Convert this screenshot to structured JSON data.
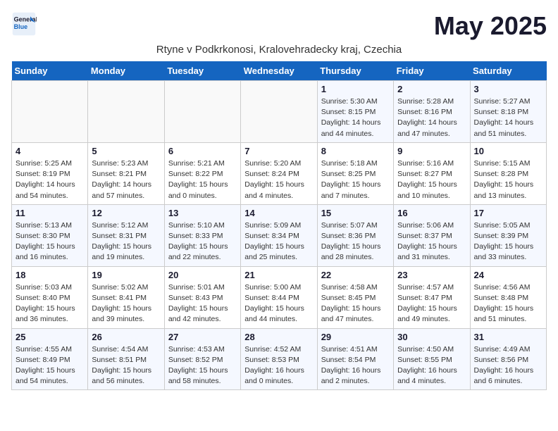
{
  "logo": {
    "line1": "General",
    "line2": "Blue"
  },
  "title": "May 2025",
  "subtitle": "Rtyne v Podkrkonosi, Kralovehradecky kraj, Czechia",
  "days_of_week": [
    "Sunday",
    "Monday",
    "Tuesday",
    "Wednesday",
    "Thursday",
    "Friday",
    "Saturday"
  ],
  "weeks": [
    [
      {
        "day": "",
        "info": ""
      },
      {
        "day": "",
        "info": ""
      },
      {
        "day": "",
        "info": ""
      },
      {
        "day": "",
        "info": ""
      },
      {
        "day": "1",
        "info": "Sunrise: 5:30 AM\nSunset: 8:15 PM\nDaylight: 14 hours\nand 44 minutes."
      },
      {
        "day": "2",
        "info": "Sunrise: 5:28 AM\nSunset: 8:16 PM\nDaylight: 14 hours\nand 47 minutes."
      },
      {
        "day": "3",
        "info": "Sunrise: 5:27 AM\nSunset: 8:18 PM\nDaylight: 14 hours\nand 51 minutes."
      }
    ],
    [
      {
        "day": "4",
        "info": "Sunrise: 5:25 AM\nSunset: 8:19 PM\nDaylight: 14 hours\nand 54 minutes."
      },
      {
        "day": "5",
        "info": "Sunrise: 5:23 AM\nSunset: 8:21 PM\nDaylight: 14 hours\nand 57 minutes."
      },
      {
        "day": "6",
        "info": "Sunrise: 5:21 AM\nSunset: 8:22 PM\nDaylight: 15 hours\nand 0 minutes."
      },
      {
        "day": "7",
        "info": "Sunrise: 5:20 AM\nSunset: 8:24 PM\nDaylight: 15 hours\nand 4 minutes."
      },
      {
        "day": "8",
        "info": "Sunrise: 5:18 AM\nSunset: 8:25 PM\nDaylight: 15 hours\nand 7 minutes."
      },
      {
        "day": "9",
        "info": "Sunrise: 5:16 AM\nSunset: 8:27 PM\nDaylight: 15 hours\nand 10 minutes."
      },
      {
        "day": "10",
        "info": "Sunrise: 5:15 AM\nSunset: 8:28 PM\nDaylight: 15 hours\nand 13 minutes."
      }
    ],
    [
      {
        "day": "11",
        "info": "Sunrise: 5:13 AM\nSunset: 8:30 PM\nDaylight: 15 hours\nand 16 minutes."
      },
      {
        "day": "12",
        "info": "Sunrise: 5:12 AM\nSunset: 8:31 PM\nDaylight: 15 hours\nand 19 minutes."
      },
      {
        "day": "13",
        "info": "Sunrise: 5:10 AM\nSunset: 8:33 PM\nDaylight: 15 hours\nand 22 minutes."
      },
      {
        "day": "14",
        "info": "Sunrise: 5:09 AM\nSunset: 8:34 PM\nDaylight: 15 hours\nand 25 minutes."
      },
      {
        "day": "15",
        "info": "Sunrise: 5:07 AM\nSunset: 8:36 PM\nDaylight: 15 hours\nand 28 minutes."
      },
      {
        "day": "16",
        "info": "Sunrise: 5:06 AM\nSunset: 8:37 PM\nDaylight: 15 hours\nand 31 minutes."
      },
      {
        "day": "17",
        "info": "Sunrise: 5:05 AM\nSunset: 8:39 PM\nDaylight: 15 hours\nand 33 minutes."
      }
    ],
    [
      {
        "day": "18",
        "info": "Sunrise: 5:03 AM\nSunset: 8:40 PM\nDaylight: 15 hours\nand 36 minutes."
      },
      {
        "day": "19",
        "info": "Sunrise: 5:02 AM\nSunset: 8:41 PM\nDaylight: 15 hours\nand 39 minutes."
      },
      {
        "day": "20",
        "info": "Sunrise: 5:01 AM\nSunset: 8:43 PM\nDaylight: 15 hours\nand 42 minutes."
      },
      {
        "day": "21",
        "info": "Sunrise: 5:00 AM\nSunset: 8:44 PM\nDaylight: 15 hours\nand 44 minutes."
      },
      {
        "day": "22",
        "info": "Sunrise: 4:58 AM\nSunset: 8:45 PM\nDaylight: 15 hours\nand 47 minutes."
      },
      {
        "day": "23",
        "info": "Sunrise: 4:57 AM\nSunset: 8:47 PM\nDaylight: 15 hours\nand 49 minutes."
      },
      {
        "day": "24",
        "info": "Sunrise: 4:56 AM\nSunset: 8:48 PM\nDaylight: 15 hours\nand 51 minutes."
      }
    ],
    [
      {
        "day": "25",
        "info": "Sunrise: 4:55 AM\nSunset: 8:49 PM\nDaylight: 15 hours\nand 54 minutes."
      },
      {
        "day": "26",
        "info": "Sunrise: 4:54 AM\nSunset: 8:51 PM\nDaylight: 15 hours\nand 56 minutes."
      },
      {
        "day": "27",
        "info": "Sunrise: 4:53 AM\nSunset: 8:52 PM\nDaylight: 15 hours\nand 58 minutes."
      },
      {
        "day": "28",
        "info": "Sunrise: 4:52 AM\nSunset: 8:53 PM\nDaylight: 16 hours\nand 0 minutes."
      },
      {
        "day": "29",
        "info": "Sunrise: 4:51 AM\nSunset: 8:54 PM\nDaylight: 16 hours\nand 2 minutes."
      },
      {
        "day": "30",
        "info": "Sunrise: 4:50 AM\nSunset: 8:55 PM\nDaylight: 16 hours\nand 4 minutes."
      },
      {
        "day": "31",
        "info": "Sunrise: 4:49 AM\nSunset: 8:56 PM\nDaylight: 16 hours\nand 6 minutes."
      }
    ]
  ]
}
